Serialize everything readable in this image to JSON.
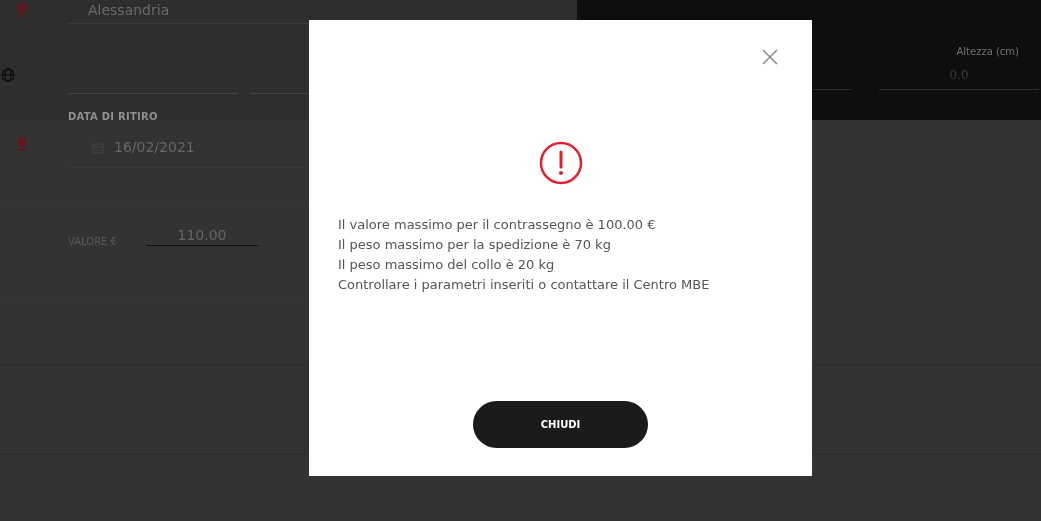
{
  "form": {
    "city": "Alessandria",
    "pickup_date_label": "DATA DI RITIRO",
    "pickup_date": "16/02/2021",
    "value_label": "VALORE €",
    "value": "110.00"
  },
  "dimensions_panel": {
    "label": "Altezza (cm)",
    "value": "0.0"
  },
  "dialog": {
    "messages": [
      "Il valore massimo per il contrassegno è 100.00 €",
      "Il peso massimo per la spedizione è 70 kg",
      "Il peso massimo del collo è 20 kg",
      "Controllare i parametri inseriti o contattare il Centro MBE"
    ],
    "button": "CHIUDI"
  }
}
